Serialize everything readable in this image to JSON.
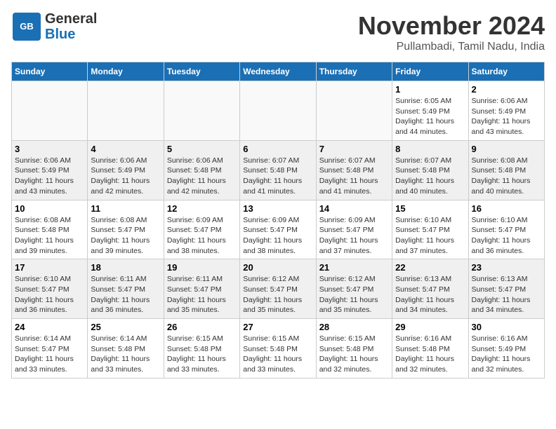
{
  "logo": {
    "line1": "General",
    "line2": "Blue"
  },
  "title": "November 2024",
  "subtitle": "Pullambadi, Tamil Nadu, India",
  "days_of_week": [
    "Sunday",
    "Monday",
    "Tuesday",
    "Wednesday",
    "Thursday",
    "Friday",
    "Saturday"
  ],
  "weeks": [
    [
      {
        "day": "",
        "info": ""
      },
      {
        "day": "",
        "info": ""
      },
      {
        "day": "",
        "info": ""
      },
      {
        "day": "",
        "info": ""
      },
      {
        "day": "",
        "info": ""
      },
      {
        "day": "1",
        "info": "Sunrise: 6:05 AM\nSunset: 5:49 PM\nDaylight: 11 hours and 44 minutes."
      },
      {
        "day": "2",
        "info": "Sunrise: 6:06 AM\nSunset: 5:49 PM\nDaylight: 11 hours and 43 minutes."
      }
    ],
    [
      {
        "day": "3",
        "info": "Sunrise: 6:06 AM\nSunset: 5:49 PM\nDaylight: 11 hours and 43 minutes."
      },
      {
        "day": "4",
        "info": "Sunrise: 6:06 AM\nSunset: 5:49 PM\nDaylight: 11 hours and 42 minutes."
      },
      {
        "day": "5",
        "info": "Sunrise: 6:06 AM\nSunset: 5:48 PM\nDaylight: 11 hours and 42 minutes."
      },
      {
        "day": "6",
        "info": "Sunrise: 6:07 AM\nSunset: 5:48 PM\nDaylight: 11 hours and 41 minutes."
      },
      {
        "day": "7",
        "info": "Sunrise: 6:07 AM\nSunset: 5:48 PM\nDaylight: 11 hours and 41 minutes."
      },
      {
        "day": "8",
        "info": "Sunrise: 6:07 AM\nSunset: 5:48 PM\nDaylight: 11 hours and 40 minutes."
      },
      {
        "day": "9",
        "info": "Sunrise: 6:08 AM\nSunset: 5:48 PM\nDaylight: 11 hours and 40 minutes."
      }
    ],
    [
      {
        "day": "10",
        "info": "Sunrise: 6:08 AM\nSunset: 5:48 PM\nDaylight: 11 hours and 39 minutes."
      },
      {
        "day": "11",
        "info": "Sunrise: 6:08 AM\nSunset: 5:47 PM\nDaylight: 11 hours and 39 minutes."
      },
      {
        "day": "12",
        "info": "Sunrise: 6:09 AM\nSunset: 5:47 PM\nDaylight: 11 hours and 38 minutes."
      },
      {
        "day": "13",
        "info": "Sunrise: 6:09 AM\nSunset: 5:47 PM\nDaylight: 11 hours and 38 minutes."
      },
      {
        "day": "14",
        "info": "Sunrise: 6:09 AM\nSunset: 5:47 PM\nDaylight: 11 hours and 37 minutes."
      },
      {
        "day": "15",
        "info": "Sunrise: 6:10 AM\nSunset: 5:47 PM\nDaylight: 11 hours and 37 minutes."
      },
      {
        "day": "16",
        "info": "Sunrise: 6:10 AM\nSunset: 5:47 PM\nDaylight: 11 hours and 36 minutes."
      }
    ],
    [
      {
        "day": "17",
        "info": "Sunrise: 6:10 AM\nSunset: 5:47 PM\nDaylight: 11 hours and 36 minutes."
      },
      {
        "day": "18",
        "info": "Sunrise: 6:11 AM\nSunset: 5:47 PM\nDaylight: 11 hours and 36 minutes."
      },
      {
        "day": "19",
        "info": "Sunrise: 6:11 AM\nSunset: 5:47 PM\nDaylight: 11 hours and 35 minutes."
      },
      {
        "day": "20",
        "info": "Sunrise: 6:12 AM\nSunset: 5:47 PM\nDaylight: 11 hours and 35 minutes."
      },
      {
        "day": "21",
        "info": "Sunrise: 6:12 AM\nSunset: 5:47 PM\nDaylight: 11 hours and 35 minutes."
      },
      {
        "day": "22",
        "info": "Sunrise: 6:13 AM\nSunset: 5:47 PM\nDaylight: 11 hours and 34 minutes."
      },
      {
        "day": "23",
        "info": "Sunrise: 6:13 AM\nSunset: 5:47 PM\nDaylight: 11 hours and 34 minutes."
      }
    ],
    [
      {
        "day": "24",
        "info": "Sunrise: 6:14 AM\nSunset: 5:47 PM\nDaylight: 11 hours and 33 minutes."
      },
      {
        "day": "25",
        "info": "Sunrise: 6:14 AM\nSunset: 5:48 PM\nDaylight: 11 hours and 33 minutes."
      },
      {
        "day": "26",
        "info": "Sunrise: 6:15 AM\nSunset: 5:48 PM\nDaylight: 11 hours and 33 minutes."
      },
      {
        "day": "27",
        "info": "Sunrise: 6:15 AM\nSunset: 5:48 PM\nDaylight: 11 hours and 33 minutes."
      },
      {
        "day": "28",
        "info": "Sunrise: 6:15 AM\nSunset: 5:48 PM\nDaylight: 11 hours and 32 minutes."
      },
      {
        "day": "29",
        "info": "Sunrise: 6:16 AM\nSunset: 5:48 PM\nDaylight: 11 hours and 32 minutes."
      },
      {
        "day": "30",
        "info": "Sunrise: 6:16 AM\nSunset: 5:49 PM\nDaylight: 11 hours and 32 minutes."
      }
    ]
  ]
}
